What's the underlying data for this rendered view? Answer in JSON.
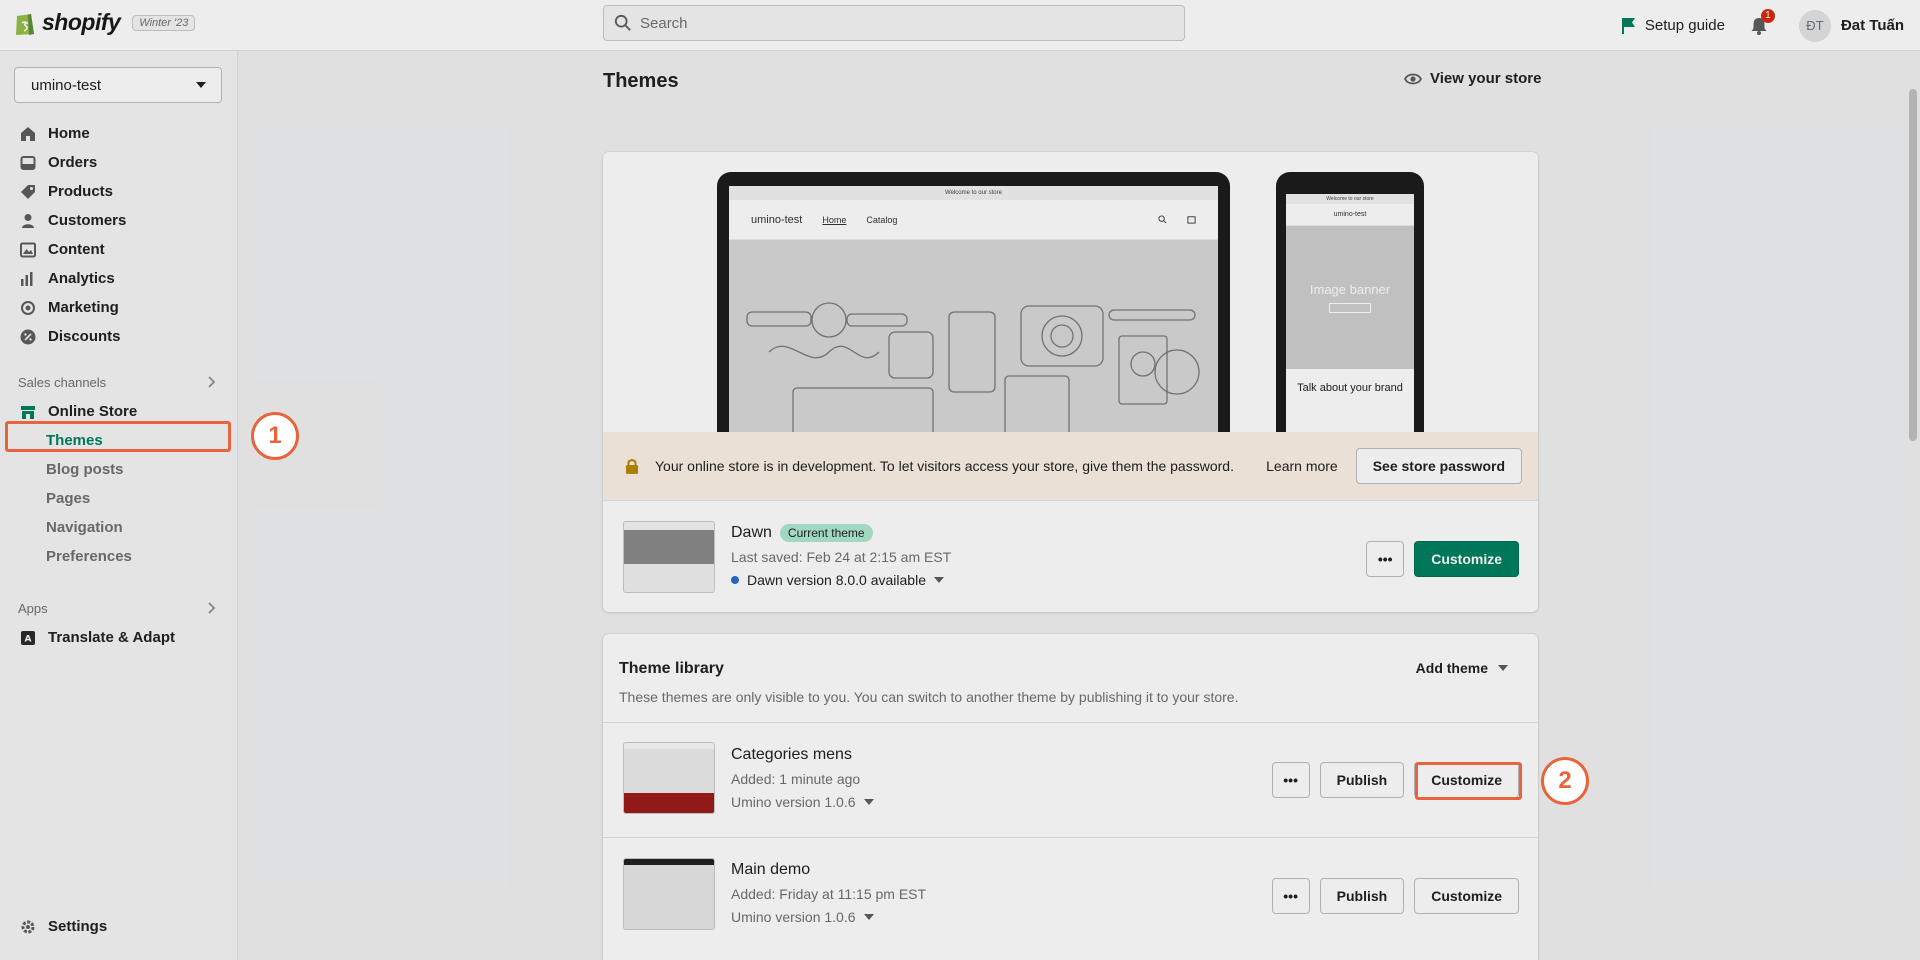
{
  "topbar": {
    "brand": "shopify",
    "edition": "Winter '23",
    "search_placeholder": "Search",
    "setup_guide": "Setup guide",
    "notification_count": "1",
    "avatar_initials": "ĐT",
    "user_name": "Đat Tuấn"
  },
  "sidebar": {
    "store_name": "umino-test",
    "items": [
      {
        "label": "Home",
        "icon": "home-icon"
      },
      {
        "label": "Orders",
        "icon": "orders-icon"
      },
      {
        "label": "Products",
        "icon": "tag-icon"
      },
      {
        "label": "Customers",
        "icon": "person-icon"
      },
      {
        "label": "Content",
        "icon": "image-icon"
      },
      {
        "label": "Analytics",
        "icon": "bar-chart-icon"
      },
      {
        "label": "Marketing",
        "icon": "target-icon"
      },
      {
        "label": "Discounts",
        "icon": "discount-icon"
      }
    ],
    "sales_channels_label": "Sales channels",
    "online_store_label": "Online Store",
    "online_store_sub": [
      "Themes",
      "Blog posts",
      "Pages",
      "Navigation",
      "Preferences"
    ],
    "apps_label": "Apps",
    "app_item": "Translate & Adapt",
    "settings_label": "Settings"
  },
  "main": {
    "title": "Themes",
    "view_store": "View your store",
    "preview": {
      "laptop_announcement": "Welcome to our store",
      "laptop_brand": "umino-test",
      "laptop_nav": [
        "Home",
        "Catalog"
      ],
      "phone_announcement": "Welcome to our store",
      "phone_brand": "umino-test",
      "phone_banner_title": "Image banner",
      "phone_about": "Talk about your brand"
    },
    "dev_banner": {
      "text": "Your online store is in development. To let visitors access your store, give them the password.",
      "learn_more": "Learn more",
      "button": "See store password"
    },
    "current_theme": {
      "name": "Dawn",
      "badge": "Current theme",
      "saved": "Last saved: Feb 24 at 2:15 am EST",
      "version": "Dawn version 8.0.0 available",
      "more": "•••",
      "customize": "Customize"
    },
    "library": {
      "title": "Theme library",
      "add_theme": "Add theme",
      "description": "These themes are only visible to you. You can switch to another theme by publishing it to your store.",
      "themes": [
        {
          "name": "Categories mens",
          "added": "Added: 1 minute ago",
          "version": "Umino version 1.0.6",
          "more": "•••",
          "publish": "Publish",
          "customize": "Customize"
        },
        {
          "name": "Main demo",
          "added": "Added: Friday at 11:15 pm EST",
          "version": "Umino version 1.0.6",
          "more": "•••",
          "publish": "Publish",
          "customize": "Customize"
        }
      ]
    }
  },
  "callouts": [
    "1",
    "2"
  ],
  "colors": {
    "accent": "#008060",
    "callout": "#e8643c",
    "badge": "#aee9d1",
    "banner": "#fcf1e7"
  }
}
